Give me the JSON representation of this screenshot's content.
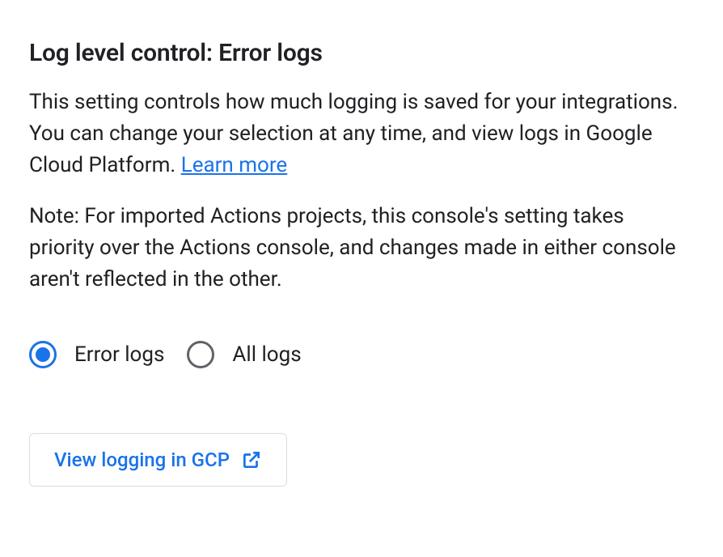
{
  "title": "Log level control: Error logs",
  "description_part1": "This setting controls how much logging is saved for your integrations. You can change your selection at any time, and view logs in Google Cloud Platform. ",
  "description_link": "Learn more",
  "note": "Note: For imported Actions projects, this console's setting takes priority over the Actions console, and changes made in either console aren't reflected in the other.",
  "radio_options": {
    "error_logs": "Error logs",
    "all_logs": "All logs"
  },
  "button_label": "View logging in GCP"
}
